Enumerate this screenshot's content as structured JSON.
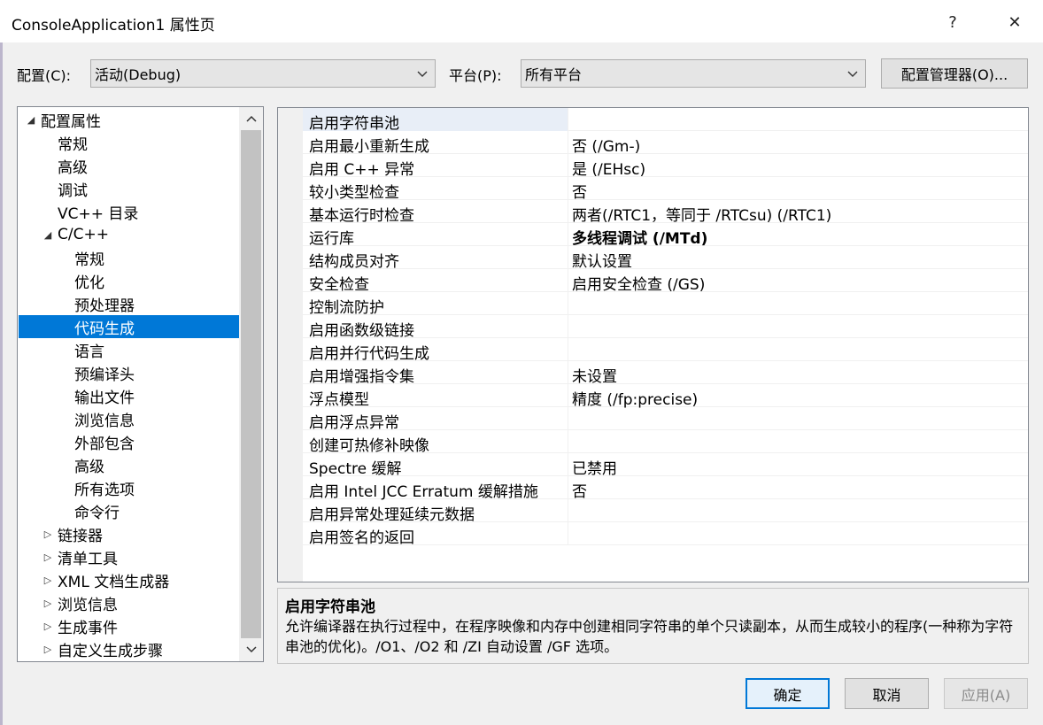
{
  "window": {
    "title": "ConsoleApplication1 属性页",
    "help_glyph": "?",
    "close_glyph": "✕"
  },
  "config": {
    "config_label": "配置(C):",
    "config_value": "活动(Debug)",
    "platform_label": "平台(P):",
    "platform_value": "所有平台",
    "manager_button": "配置管理器(O)..."
  },
  "tree": {
    "items": [
      {
        "label": "配置属性",
        "arrow": "◢"
      },
      {
        "label": "常规"
      },
      {
        "label": "高级"
      },
      {
        "label": "调试"
      },
      {
        "label": "VC++ 目录"
      },
      {
        "label": "C/C++",
        "arrow": "◢"
      },
      {
        "label": "常规"
      },
      {
        "label": "优化"
      },
      {
        "label": "预处理器"
      },
      {
        "label": "代码生成"
      },
      {
        "label": "语言"
      },
      {
        "label": "预编译头"
      },
      {
        "label": "输出文件"
      },
      {
        "label": "浏览信息"
      },
      {
        "label": "外部包含"
      },
      {
        "label": "高级"
      },
      {
        "label": "所有选项"
      },
      {
        "label": "命令行"
      },
      {
        "label": "链接器",
        "arrow": "▷"
      },
      {
        "label": "清单工具",
        "arrow": "▷"
      },
      {
        "label": "XML 文档生成器",
        "arrow": "▷"
      },
      {
        "label": "浏览信息",
        "arrow": "▷"
      },
      {
        "label": "生成事件",
        "arrow": "▷"
      },
      {
        "label": "自定义生成步骤",
        "arrow": "▷"
      }
    ],
    "selected_index": 9
  },
  "properties": {
    "rows": [
      {
        "name": "启用字符串池",
        "value": ""
      },
      {
        "name": "启用最小重新生成",
        "value": "否 (/Gm-)"
      },
      {
        "name": "启用 C++ 异常",
        "value": "是 (/EHsc)"
      },
      {
        "name": "较小类型检查",
        "value": "否"
      },
      {
        "name": "基本运行时检查",
        "value": "两者(/RTC1，等同于 /RTCsu) (/RTC1)"
      },
      {
        "name": "运行库",
        "value": "多线程调试 (/MTd)",
        "bold": true
      },
      {
        "name": "结构成员对齐",
        "value": "默认设置"
      },
      {
        "name": "安全检查",
        "value": "启用安全检查 (/GS)"
      },
      {
        "name": "控制流防护",
        "value": ""
      },
      {
        "name": "启用函数级链接",
        "value": ""
      },
      {
        "name": "启用并行代码生成",
        "value": ""
      },
      {
        "name": "启用增强指令集",
        "value": "未设置"
      },
      {
        "name": "浮点模型",
        "value": "精度 (/fp:precise)"
      },
      {
        "name": "启用浮点异常",
        "value": ""
      },
      {
        "name": "创建可热修补映像",
        "value": ""
      },
      {
        "name": "Spectre 缓解",
        "value": "已禁用"
      },
      {
        "name": "启用 Intel JCC Erratum 缓解措施",
        "value": "否"
      },
      {
        "name": "启用异常处理延续元数据",
        "value": ""
      },
      {
        "name": "启用签名的返回",
        "value": ""
      }
    ]
  },
  "description": {
    "title": "启用字符串池",
    "text": "允许编译器在执行过程中，在程序映像和内存中创建相同字符串的单个只读副本，从而生成较小的程序(一种称为字符串池的优化)。/O1、/O2 和 /ZI 自动设置 /GF 选项。"
  },
  "buttons": {
    "ok": "确定",
    "cancel": "取消",
    "apply": "应用(A)"
  },
  "colors": {
    "selection": "#0078d7",
    "background": "#f0f0f0"
  }
}
